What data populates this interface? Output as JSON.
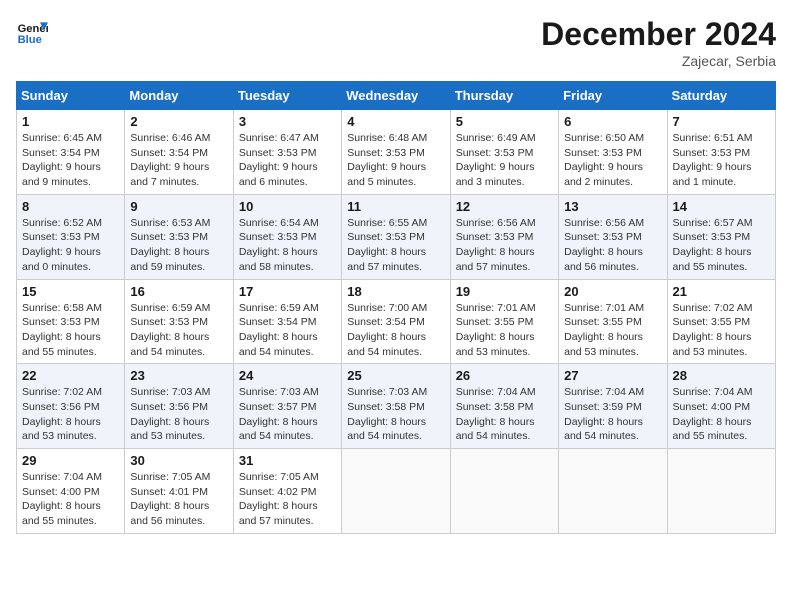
{
  "logo": {
    "line1": "General",
    "line2": "Blue"
  },
  "title": "December 2024",
  "subtitle": "Zajecar, Serbia",
  "days_of_week": [
    "Sunday",
    "Monday",
    "Tuesday",
    "Wednesday",
    "Thursday",
    "Friday",
    "Saturday"
  ],
  "weeks": [
    [
      {
        "day": "1",
        "sunrise": "6:45 AM",
        "sunset": "3:54 PM",
        "daylight": "9 hours and 9 minutes."
      },
      {
        "day": "2",
        "sunrise": "6:46 AM",
        "sunset": "3:54 PM",
        "daylight": "9 hours and 7 minutes."
      },
      {
        "day": "3",
        "sunrise": "6:47 AM",
        "sunset": "3:53 PM",
        "daylight": "9 hours and 6 minutes."
      },
      {
        "day": "4",
        "sunrise": "6:48 AM",
        "sunset": "3:53 PM",
        "daylight": "9 hours and 5 minutes."
      },
      {
        "day": "5",
        "sunrise": "6:49 AM",
        "sunset": "3:53 PM",
        "daylight": "9 hours and 3 minutes."
      },
      {
        "day": "6",
        "sunrise": "6:50 AM",
        "sunset": "3:53 PM",
        "daylight": "9 hours and 2 minutes."
      },
      {
        "day": "7",
        "sunrise": "6:51 AM",
        "sunset": "3:53 PM",
        "daylight": "9 hours and 1 minute."
      }
    ],
    [
      {
        "day": "8",
        "sunrise": "6:52 AM",
        "sunset": "3:53 PM",
        "daylight": "9 hours and 0 minutes."
      },
      {
        "day": "9",
        "sunrise": "6:53 AM",
        "sunset": "3:53 PM",
        "daylight": "8 hours and 59 minutes."
      },
      {
        "day": "10",
        "sunrise": "6:54 AM",
        "sunset": "3:53 PM",
        "daylight": "8 hours and 58 minutes."
      },
      {
        "day": "11",
        "sunrise": "6:55 AM",
        "sunset": "3:53 PM",
        "daylight": "8 hours and 57 minutes."
      },
      {
        "day": "12",
        "sunrise": "6:56 AM",
        "sunset": "3:53 PM",
        "daylight": "8 hours and 57 minutes."
      },
      {
        "day": "13",
        "sunrise": "6:56 AM",
        "sunset": "3:53 PM",
        "daylight": "8 hours and 56 minutes."
      },
      {
        "day": "14",
        "sunrise": "6:57 AM",
        "sunset": "3:53 PM",
        "daylight": "8 hours and 55 minutes."
      }
    ],
    [
      {
        "day": "15",
        "sunrise": "6:58 AM",
        "sunset": "3:53 PM",
        "daylight": "8 hours and 55 minutes."
      },
      {
        "day": "16",
        "sunrise": "6:59 AM",
        "sunset": "3:53 PM",
        "daylight": "8 hours and 54 minutes."
      },
      {
        "day": "17",
        "sunrise": "6:59 AM",
        "sunset": "3:54 PM",
        "daylight": "8 hours and 54 minutes."
      },
      {
        "day": "18",
        "sunrise": "7:00 AM",
        "sunset": "3:54 PM",
        "daylight": "8 hours and 54 minutes."
      },
      {
        "day": "19",
        "sunrise": "7:01 AM",
        "sunset": "3:55 PM",
        "daylight": "8 hours and 53 minutes."
      },
      {
        "day": "20",
        "sunrise": "7:01 AM",
        "sunset": "3:55 PM",
        "daylight": "8 hours and 53 minutes."
      },
      {
        "day": "21",
        "sunrise": "7:02 AM",
        "sunset": "3:55 PM",
        "daylight": "8 hours and 53 minutes."
      }
    ],
    [
      {
        "day": "22",
        "sunrise": "7:02 AM",
        "sunset": "3:56 PM",
        "daylight": "8 hours and 53 minutes."
      },
      {
        "day": "23",
        "sunrise": "7:03 AM",
        "sunset": "3:56 PM",
        "daylight": "8 hours and 53 minutes."
      },
      {
        "day": "24",
        "sunrise": "7:03 AM",
        "sunset": "3:57 PM",
        "daylight": "8 hours and 54 minutes."
      },
      {
        "day": "25",
        "sunrise": "7:03 AM",
        "sunset": "3:58 PM",
        "daylight": "8 hours and 54 minutes."
      },
      {
        "day": "26",
        "sunrise": "7:04 AM",
        "sunset": "3:58 PM",
        "daylight": "8 hours and 54 minutes."
      },
      {
        "day": "27",
        "sunrise": "7:04 AM",
        "sunset": "3:59 PM",
        "daylight": "8 hours and 54 minutes."
      },
      {
        "day": "28",
        "sunrise": "7:04 AM",
        "sunset": "4:00 PM",
        "daylight": "8 hours and 55 minutes."
      }
    ],
    [
      {
        "day": "29",
        "sunrise": "7:04 AM",
        "sunset": "4:00 PM",
        "daylight": "8 hours and 55 minutes."
      },
      {
        "day": "30",
        "sunrise": "7:05 AM",
        "sunset": "4:01 PM",
        "daylight": "8 hours and 56 minutes."
      },
      {
        "day": "31",
        "sunrise": "7:05 AM",
        "sunset": "4:02 PM",
        "daylight": "8 hours and 57 minutes."
      },
      null,
      null,
      null,
      null
    ]
  ]
}
